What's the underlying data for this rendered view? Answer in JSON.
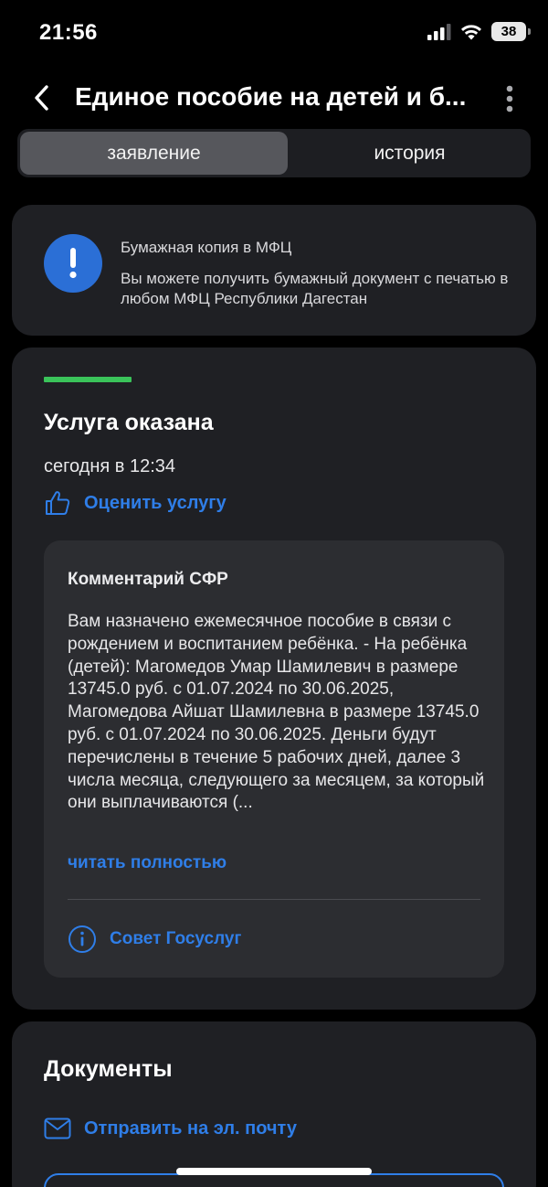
{
  "status_bar": {
    "time": "21:56",
    "battery": "38"
  },
  "header": {
    "title": "Единое пособие на детей и б..."
  },
  "tabs": [
    {
      "label": "заявление",
      "active": true
    },
    {
      "label": "история",
      "active": false
    }
  ],
  "mfc_notice": {
    "title": "Бумажная копия в МФЦ",
    "text": "Вы можете получить бумажный документ с печатью в любом МФЦ Республики Дагестан"
  },
  "service_status": {
    "title": "Услуга оказана",
    "time": "сегодня в 12:34",
    "rate_label": "Оценить услугу"
  },
  "comment": {
    "title": "Комментарий СФР",
    "text": "Вам назначено ежемесячное пособие в связи с рождением и воспитанием ребёнка. - На ребёнка (детей): Магомедов Умар Шамилевич в размере 13745.0 руб. с 01.07.2024 по 30.06.2025, Магомедова Айшат Шамилевна в размере 13745.0 руб. с 01.07.2024 по 30.06.2025. Деньги будут перечислены в течение 5 рабочих дней, далее 3 числа месяца, следующего за месяцем, за который они выплачиваются (...",
    "read_more": "читать полностью",
    "advice_label": "Совет Госуслуг"
  },
  "documents": {
    "title": "Документы",
    "email_label": "Отправить на эл. почту"
  },
  "colors": {
    "accent": "#2f7ee8",
    "success": "#3ac35a",
    "alert": "#2b6fd6",
    "card": "#1f2024",
    "background": "#000000"
  },
  "icons": [
    "back-chevron-icon",
    "more-vertical-icon",
    "exclamation-icon",
    "thumbs-up-icon",
    "info-icon",
    "mail-icon",
    "signal-icon",
    "wifi-icon",
    "battery-icon"
  ]
}
